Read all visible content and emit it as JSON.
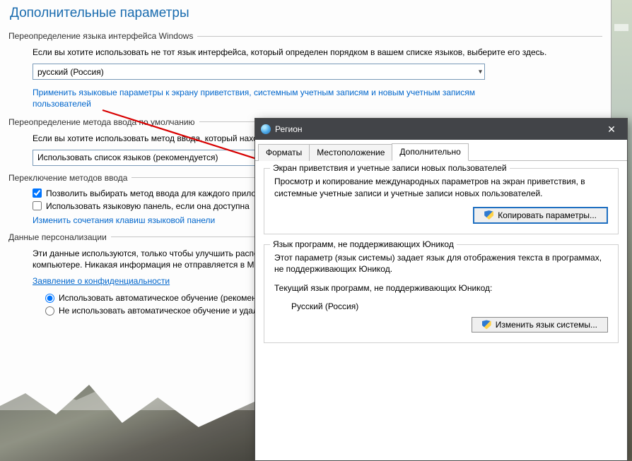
{
  "page": {
    "title": "Дополнительные параметры",
    "group1": {
      "title": "Переопределение языка интерфейса Windows",
      "desc": "Если вы хотите использовать не тот язык интерфейса, который определен порядком в вашем списке языков, выберите его здесь.",
      "combo_value": "русский (Россия)",
      "link": "Применить языковые параметры к экрану приветствия, системным учетным записям и новым учетным записям пользователей"
    },
    "group2": {
      "title": "Переопределение метода ввода по умолчанию",
      "desc": "Если вы хотите использовать метод ввода, который находится первым в списке, выберите его здесь.",
      "combo_value": "Использовать список языков (рекомендуется)"
    },
    "group3": {
      "title": "Переключение методов ввода",
      "check1": "Позволить выбирать метод ввода для каждого приложения",
      "check2": "Использовать языковую панель, если она доступна",
      "link": "Изменить сочетания клавиш языковой панели"
    },
    "group4": {
      "title": "Данные персонализации",
      "desc": "Эти данные используются, только чтобы улучшить распознавание рукописного ввода и ввод текста для языков без IME на этом компьютере. Никакая информация не отправляется в Microsoft.",
      "privacy_link": "Заявление о конфиденциальности",
      "radio1": "Использовать автоматическое обучение (рекомендуется)",
      "radio2": "Не использовать автоматическое обучение и удалить все ранее собранные данные"
    }
  },
  "dialog": {
    "title": "Регион",
    "tabs": {
      "t1": "Форматы",
      "t2": "Местоположение",
      "t3": "Дополнительно"
    },
    "fs1": {
      "legend": "Экран приветствия и учетные записи новых пользователей",
      "text": "Просмотр и копирование международных параметров на экран приветствия, в системные учетные записи и учетные записи новых пользователей.",
      "button": "Копировать параметры..."
    },
    "fs2": {
      "legend": "Язык программ, не поддерживающих Юникод",
      "text": "Этот параметр (язык системы) задает язык для отображения текста в программах, не поддерживающих Юникод.",
      "current_label": "Текущий язык программ, не поддерживающих Юникод:",
      "current_value": "Русский (Россия)",
      "button": "Изменить язык системы..."
    }
  }
}
